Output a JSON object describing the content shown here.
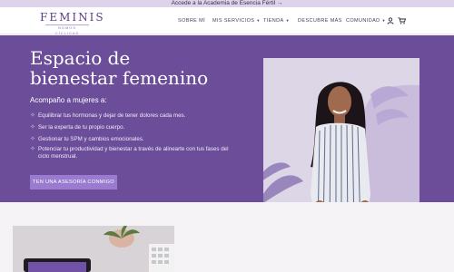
{
  "announcement": {
    "text": "Accede a la Academia de Esencia Fértil",
    "arrow": "→"
  },
  "brand": {
    "name": "FEMINIS",
    "tagline": "NOMOS CÍCLICAS"
  },
  "nav": {
    "items": [
      {
        "label": "SOBRE MÍ",
        "has_caret": false
      },
      {
        "label": "MIS SERVICIOS",
        "has_caret": true,
        "caret": "▼"
      },
      {
        "label": "TIENDA",
        "has_caret": true,
        "caret": "▼"
      },
      {
        "label": "DESCUBRE MÁS",
        "has_caret": false
      },
      {
        "label": "COMUNIDAD",
        "has_caret": true,
        "caret": "▼"
      }
    ],
    "icons": [
      "user-icon",
      "cart-icon"
    ]
  },
  "hero": {
    "title_line1": "Espacio de",
    "title_line2": "bienestar femenino",
    "subtitle": "Acompaño a mujeres a:",
    "benefits": [
      "Equilibrar tus hormonas y dejar de tener dolores cada mes.",
      "Ser la experta de tu propio cuerpo.",
      "Gestionar tu SPM y cambios emocionales.",
      "Potenciar tu productividad y bienestar a través de alinearte con tus fases del ciclo menstrual."
    ],
    "cta_label": "TEN UNA ASESORÍA CONMIGO"
  },
  "colors": {
    "hero_bg": "#6b4d9a",
    "accent": "#9b7bd0",
    "topbar_bg": "#ddd4ea",
    "brand": "#5e3b87"
  }
}
